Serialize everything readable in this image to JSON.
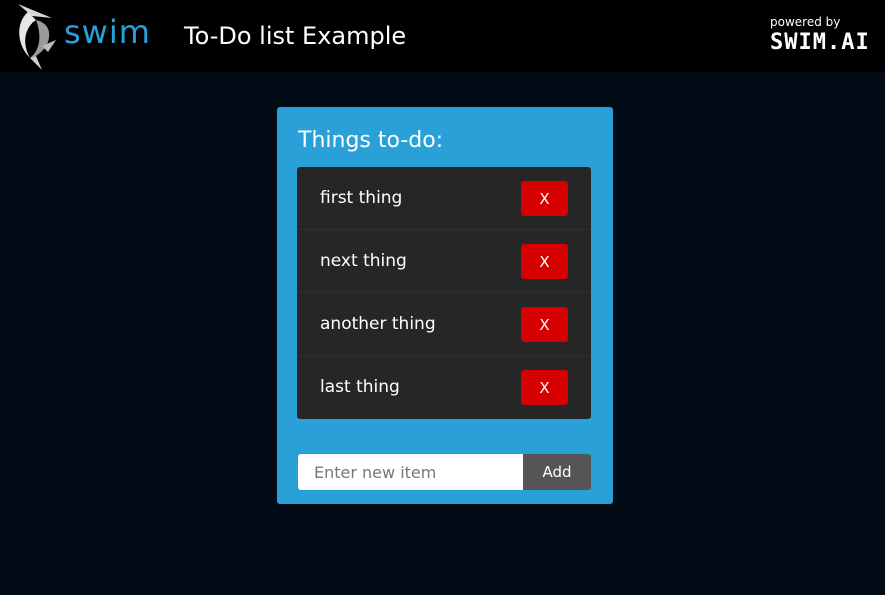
{
  "header": {
    "logo_text": "swim",
    "title": "To-Do list Example",
    "powered_by": "powered by",
    "brand": "SWIM.AI"
  },
  "todo": {
    "heading": "Things to-do:",
    "items": [
      {
        "label": "first thing",
        "remove_label": "X"
      },
      {
        "label": "next thing",
        "remove_label": "X"
      },
      {
        "label": "another thing",
        "remove_label": "X"
      },
      {
        "label": "last thing",
        "remove_label": "X"
      }
    ],
    "input": {
      "placeholder": "Enter new item",
      "value": ""
    },
    "add_label": "Add"
  },
  "colors": {
    "background": "#020c16",
    "header": "#000000",
    "accent": "#2aa0d8",
    "list_bg": "#262626",
    "remove": "#d70000",
    "add": "#555555"
  },
  "icons": {
    "logo": "swordfish-icon"
  }
}
